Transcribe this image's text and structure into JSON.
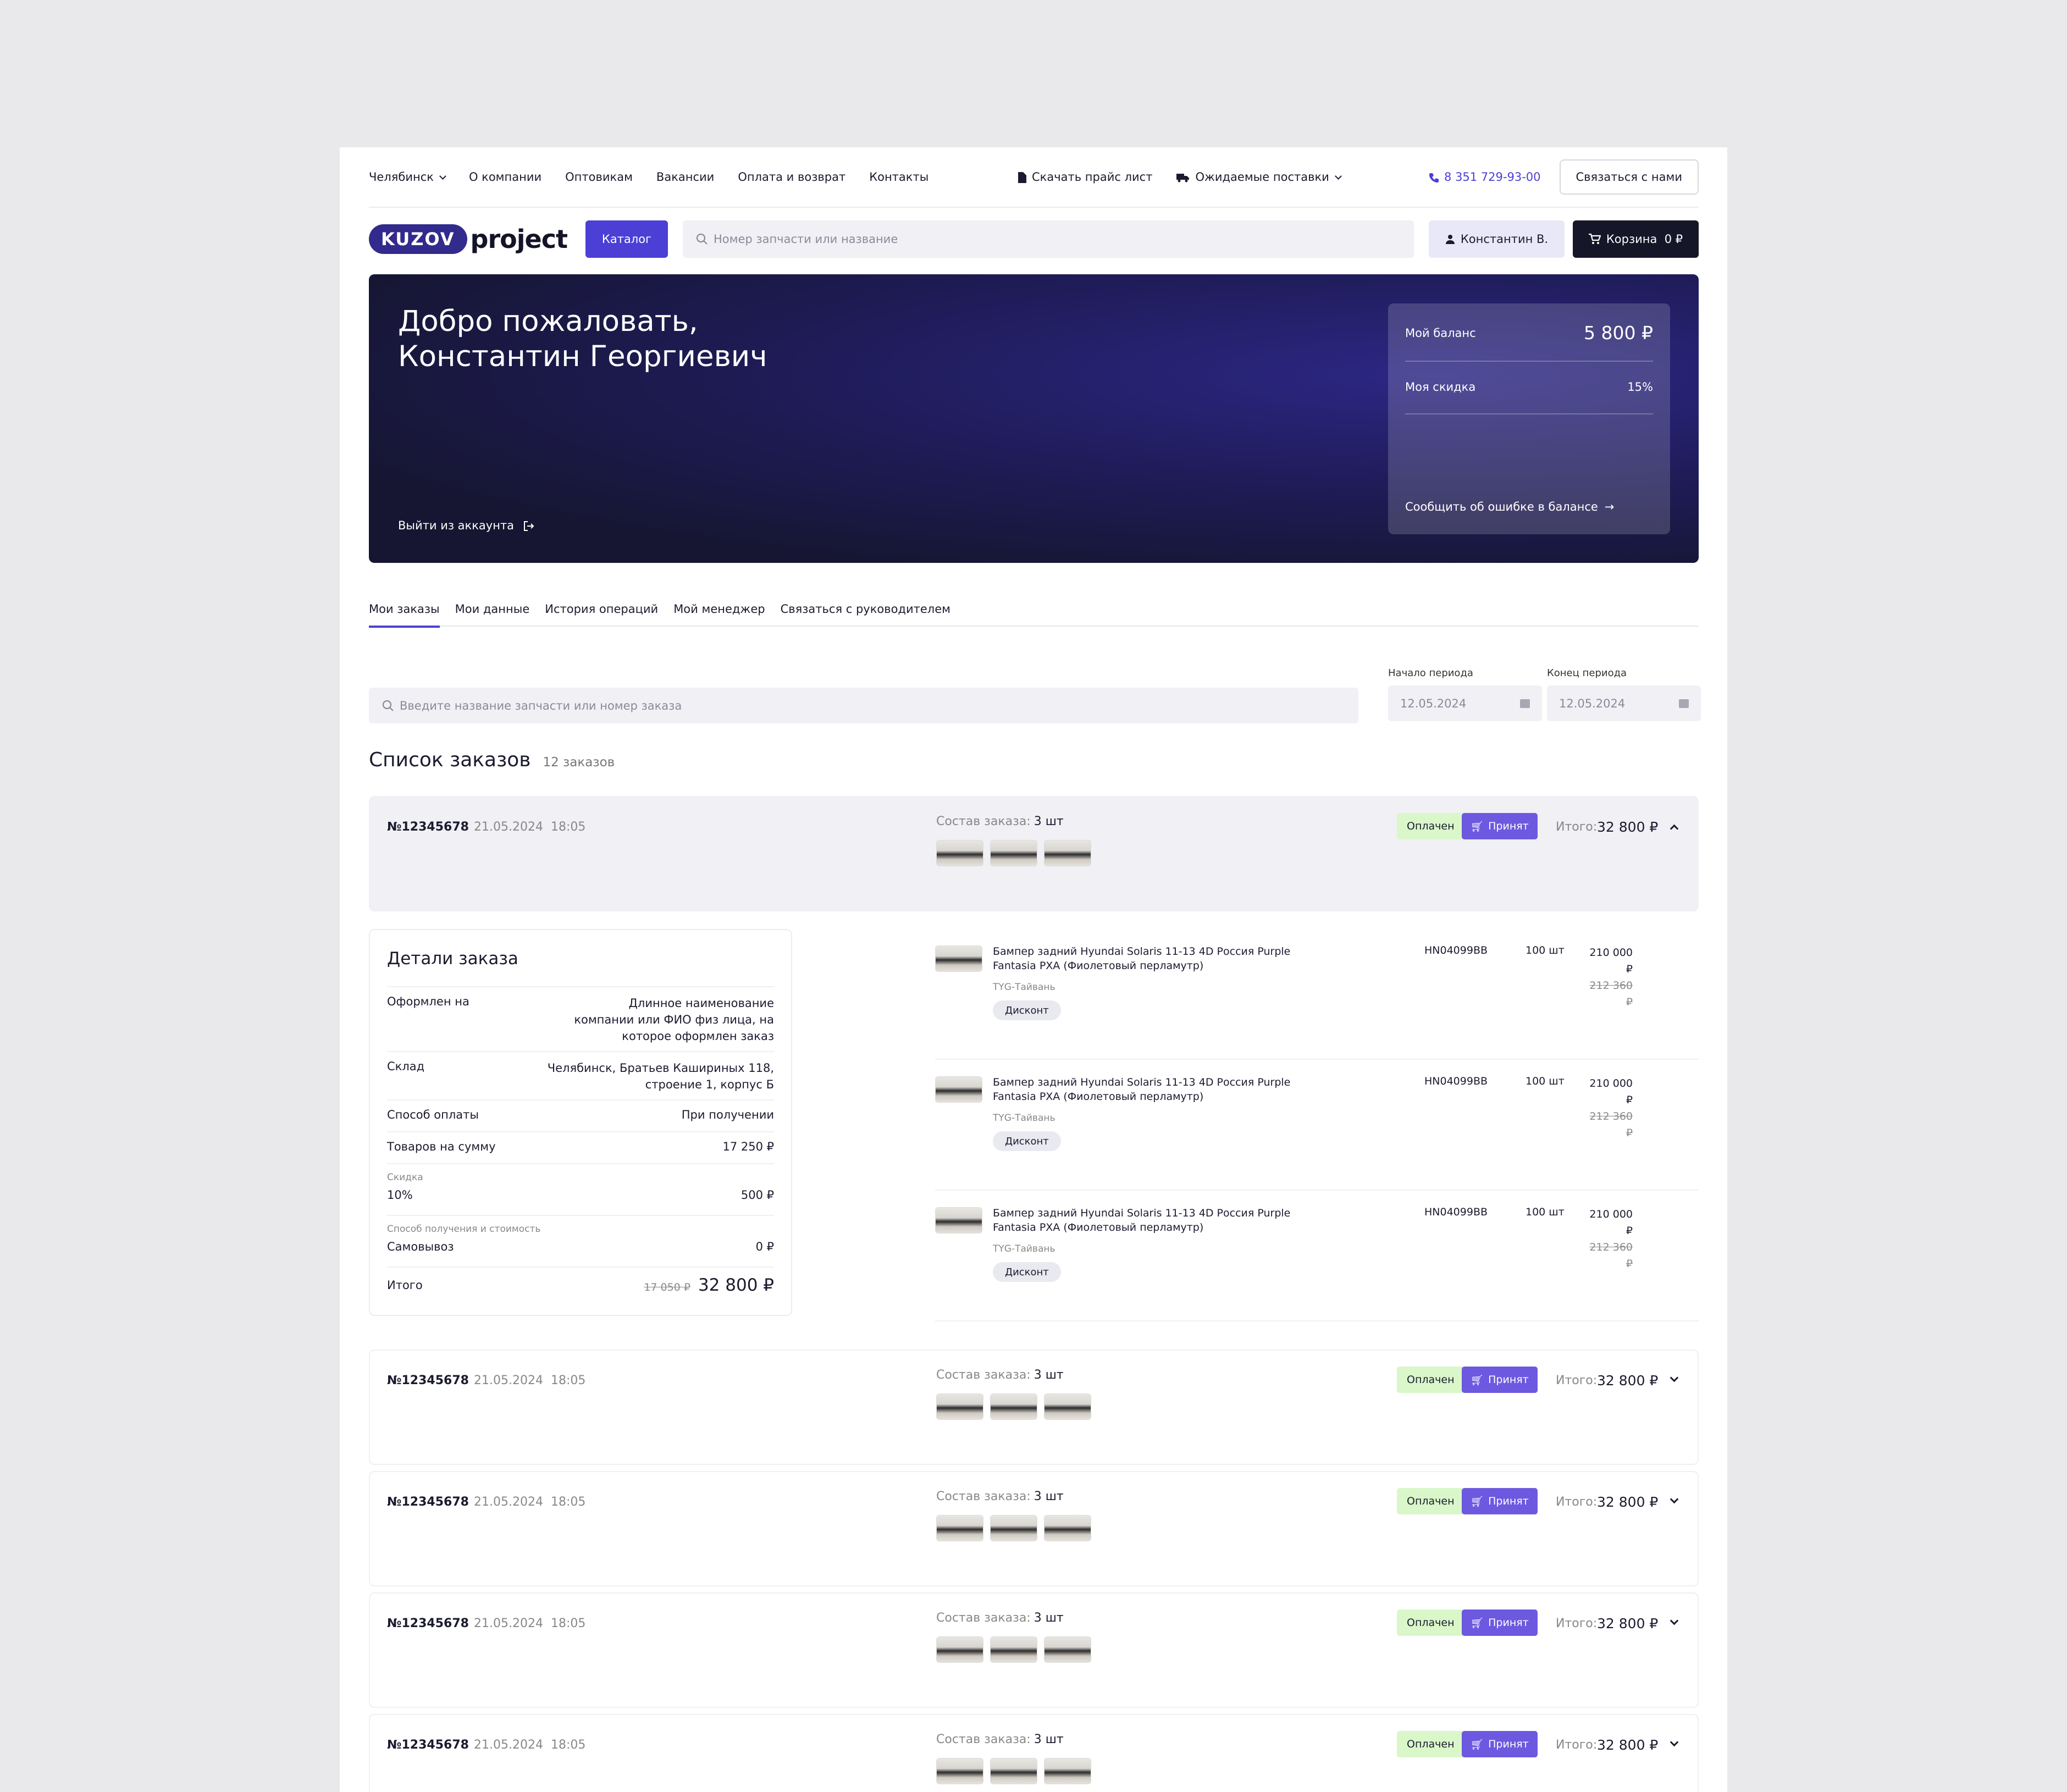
{
  "topbar": {
    "city": "Челябинск",
    "nav": [
      "О компании",
      "Оптовикам",
      "Вакансии",
      "Оплата и возврат",
      "Контакты"
    ],
    "price_list": "Скачать прайс лист",
    "deliveries": "Ожидаемые поставки",
    "phone": "8 351 729-93-00",
    "contact_btn": "Связаться с нами"
  },
  "header": {
    "logo_a": "KUZOV",
    "logo_b": "project",
    "catalog": "Каталог",
    "search_placeholder": "Номер запчасти или название",
    "user": "Константин В.",
    "cart": "Корзина",
    "cart_sum": "0 ₽"
  },
  "hero": {
    "greeting_line1": "Добро пожаловать,",
    "greeting_line2": "Константин Георгиевич",
    "logout": "Выйти из аккаунта",
    "balance_label": "Мой баланс",
    "balance_value": "5 800 ₽",
    "discount_label": "Моя скидка",
    "discount_value": "15%",
    "report": "Сообщить об ошибке в балансе"
  },
  "tabs": [
    "Мои заказы",
    "Мои данные",
    "История операций",
    "Мой менеджер",
    "Связаться с руководителем"
  ],
  "filters": {
    "search_placeholder": "Введите название запчасти или номер заказа",
    "start_label": "Начало периода",
    "start_value": "12.05.2024",
    "end_label": "Конец периода",
    "end_value": "12.05.2024"
  },
  "list": {
    "title": "Список заказов",
    "count": "12 заказов"
  },
  "order": {
    "number": "№12345678",
    "date": "21.05.2024",
    "time": "18:05",
    "composition_label": "Состав заказа:",
    "composition_value": "3 шт",
    "status_paid": "Оплачен",
    "status_accepted": "Принят",
    "total_label": "Итого:",
    "total_value": "32 800 ₽"
  },
  "details": {
    "title": "Детали заказа",
    "issued_label": "Оформлен на",
    "issued_value": "Длинное наименование компании или ФИО физ лица, на которое оформлен заказ",
    "warehouse_label": "Склад",
    "warehouse_value": "Челябинск, Братьев Кашириных 118, строение 1, корпус Б",
    "payment_label": "Способ оплаты",
    "payment_value": "При получении",
    "goods_label": "Товаров на сумму",
    "goods_value": "17 250 ₽",
    "discount_caption": "Скидка",
    "discount_pct": "10%",
    "discount_value": "500 ₽",
    "delivery_caption": "Способ получения и стоимость",
    "delivery_method": "Самовывоз",
    "delivery_value": "0 ₽",
    "total_label": "Итого",
    "total_old": "17 050 ₽",
    "total_value": "32 800 ₽"
  },
  "item": {
    "name": "Бампер задний Hyundai Solaris 11-13 4D Россия Purple Fantasia PXA (Фиолетовый перламутр)",
    "origin": "TYG-Тайвань",
    "tag": "Дисконт",
    "code": "HN04099BB",
    "qty": "100 шт",
    "price": "210 000 ₽",
    "old_price": "212 360 ₽"
  }
}
